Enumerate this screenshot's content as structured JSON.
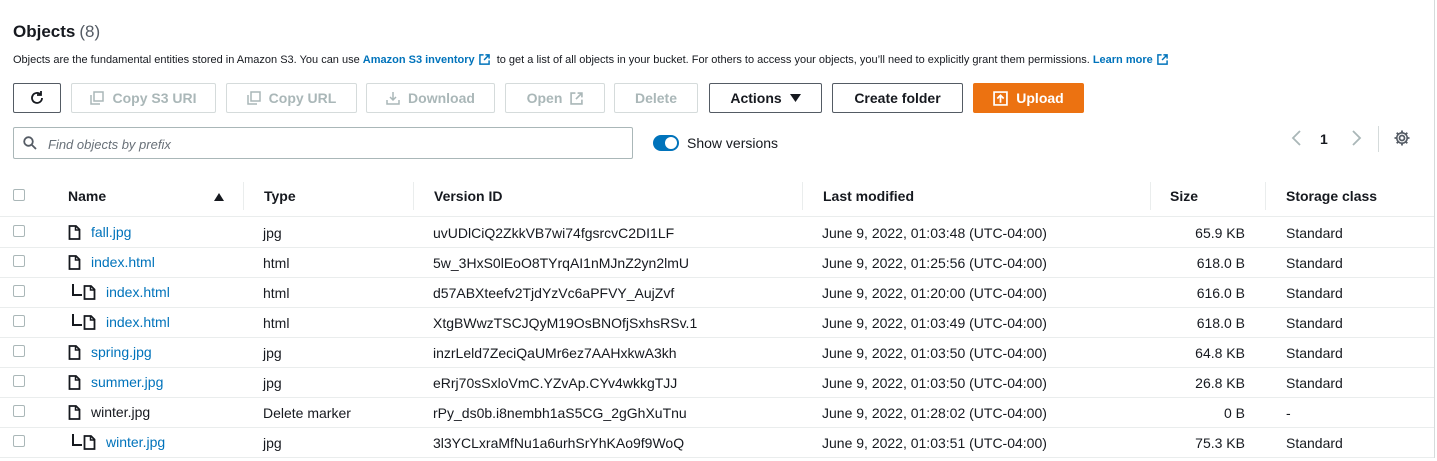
{
  "header": {
    "title": "Objects",
    "count": "(8)"
  },
  "description": {
    "text1": "Objects are the fundamental entities stored in Amazon S3. You can use ",
    "link1": "Amazon S3 inventory",
    "text2": " to get a list of all objects in your bucket. For others to access your objects, you’ll need to explicitly grant them permissions. ",
    "link2": "Learn more"
  },
  "toolbar": {
    "refresh_icon": "refresh-icon",
    "copy_s3_uri": "Copy S3 URI",
    "copy_url": "Copy URL",
    "download": "Download",
    "open": "Open",
    "delete": "Delete",
    "actions": "Actions",
    "create_folder": "Create folder",
    "upload": "Upload"
  },
  "search": {
    "placeholder": "Find objects by prefix",
    "value": ""
  },
  "versions_toggle": {
    "label": "Show versions",
    "on": true
  },
  "pagination": {
    "page": "1"
  },
  "table": {
    "columns": [
      "Name",
      "Type",
      "Version ID",
      "Last modified",
      "Size",
      "Storage class"
    ],
    "sort": {
      "column": "Name",
      "direction": "ascending"
    },
    "rows": [
      {
        "name": "fall.jpg",
        "version": false,
        "link": true,
        "type": "jpg",
        "version_id": "uvUDlCiQ2ZkkVB7wi74fgsrcvC2DI1LF",
        "last_modified": "June 9, 2022, 01:03:48 (UTC-04:00)",
        "size": "65.9 KB",
        "storage_class": "Standard"
      },
      {
        "name": "index.html",
        "version": false,
        "link": true,
        "type": "html",
        "version_id": "5w_3HxS0lEoO8TYrqAI1nMJnZ2yn2lmU",
        "last_modified": "June 9, 2022, 01:25:56 (UTC-04:00)",
        "size": "618.0 B",
        "storage_class": "Standard"
      },
      {
        "name": "index.html",
        "version": true,
        "link": true,
        "type": "html",
        "version_id": "d57ABXteefv2TjdYzVc6aPFVY_AujZvf",
        "last_modified": "June 9, 2022, 01:20:00 (UTC-04:00)",
        "size": "616.0 B",
        "storage_class": "Standard"
      },
      {
        "name": "index.html",
        "version": true,
        "link": true,
        "type": "html",
        "version_id": "XtgBWwzTSCJQyM19OsBNOfjSxhsRSv.1",
        "last_modified": "June 9, 2022, 01:03:49 (UTC-04:00)",
        "size": "618.0 B",
        "storage_class": "Standard"
      },
      {
        "name": "spring.jpg",
        "version": false,
        "link": true,
        "type": "jpg",
        "version_id": "inzrLeld7ZeciQaUMr6ez7AAHxkwA3kh",
        "last_modified": "June 9, 2022, 01:03:50 (UTC-04:00)",
        "size": "64.8 KB",
        "storage_class": "Standard"
      },
      {
        "name": "summer.jpg",
        "version": false,
        "link": true,
        "type": "jpg",
        "version_id": "eRrj70sSxloVmC.YZvAp.CYv4wkkgTJJ",
        "last_modified": "June 9, 2022, 01:03:50 (UTC-04:00)",
        "size": "26.8 KB",
        "storage_class": "Standard"
      },
      {
        "name": "winter.jpg",
        "version": false,
        "link": false,
        "type": "Delete marker",
        "version_id": "rPy_ds0b.i8nembh1aS5CG_2gGhXuTnu",
        "last_modified": "June 9, 2022, 01:28:02 (UTC-04:00)",
        "size": "0 B",
        "storage_class": "-"
      },
      {
        "name": "winter.jpg",
        "version": true,
        "link": true,
        "type": "jpg",
        "version_id": "3l3YCLxraMfNu1a6urhSrYhKAo9f9WoQ",
        "last_modified": "June 9, 2022, 01:03:51 (UTC-04:00)",
        "size": "75.3 KB",
        "storage_class": "Standard"
      }
    ]
  },
  "colors": {
    "link": "#0073bb",
    "primary": "#ec7211",
    "toggle": "#0073bb",
    "disabled": "#aab7b8"
  }
}
